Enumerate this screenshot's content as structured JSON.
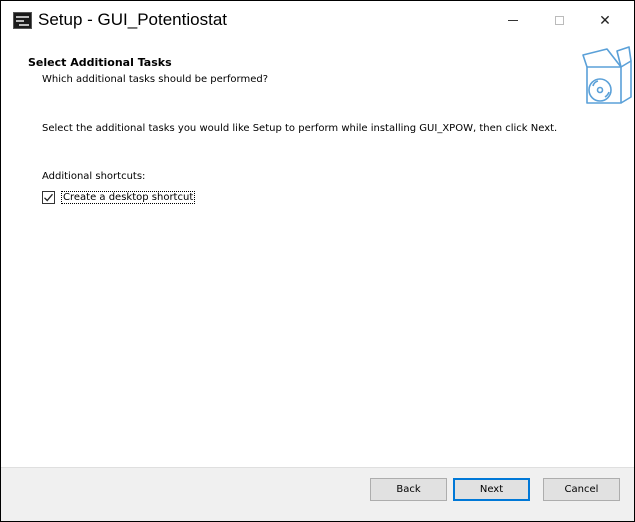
{
  "window": {
    "title": "Setup - GUI_Potentiostat",
    "minimize_glyph": "",
    "close_glyph": "✕"
  },
  "header": {
    "title": "Select Additional Tasks",
    "subtitle": "Which additional tasks should be performed?",
    "icon": "setup-box-disc-icon"
  },
  "main": {
    "description": "Select the additional tasks you would like Setup to perform while installing GUI_XPOW, then click Next.",
    "group_label": "Additional shortcuts:",
    "tasks": [
      {
        "label": "Create a desktop shortcut",
        "checked": true
      }
    ]
  },
  "footer": {
    "back_label": "Back",
    "next_label": "Next",
    "cancel_label": "Cancel"
  },
  "colors": {
    "default_button_border": "#0078d7",
    "footer_bg": "#f0f0f0",
    "icon_blue": "#5aa0d8"
  }
}
